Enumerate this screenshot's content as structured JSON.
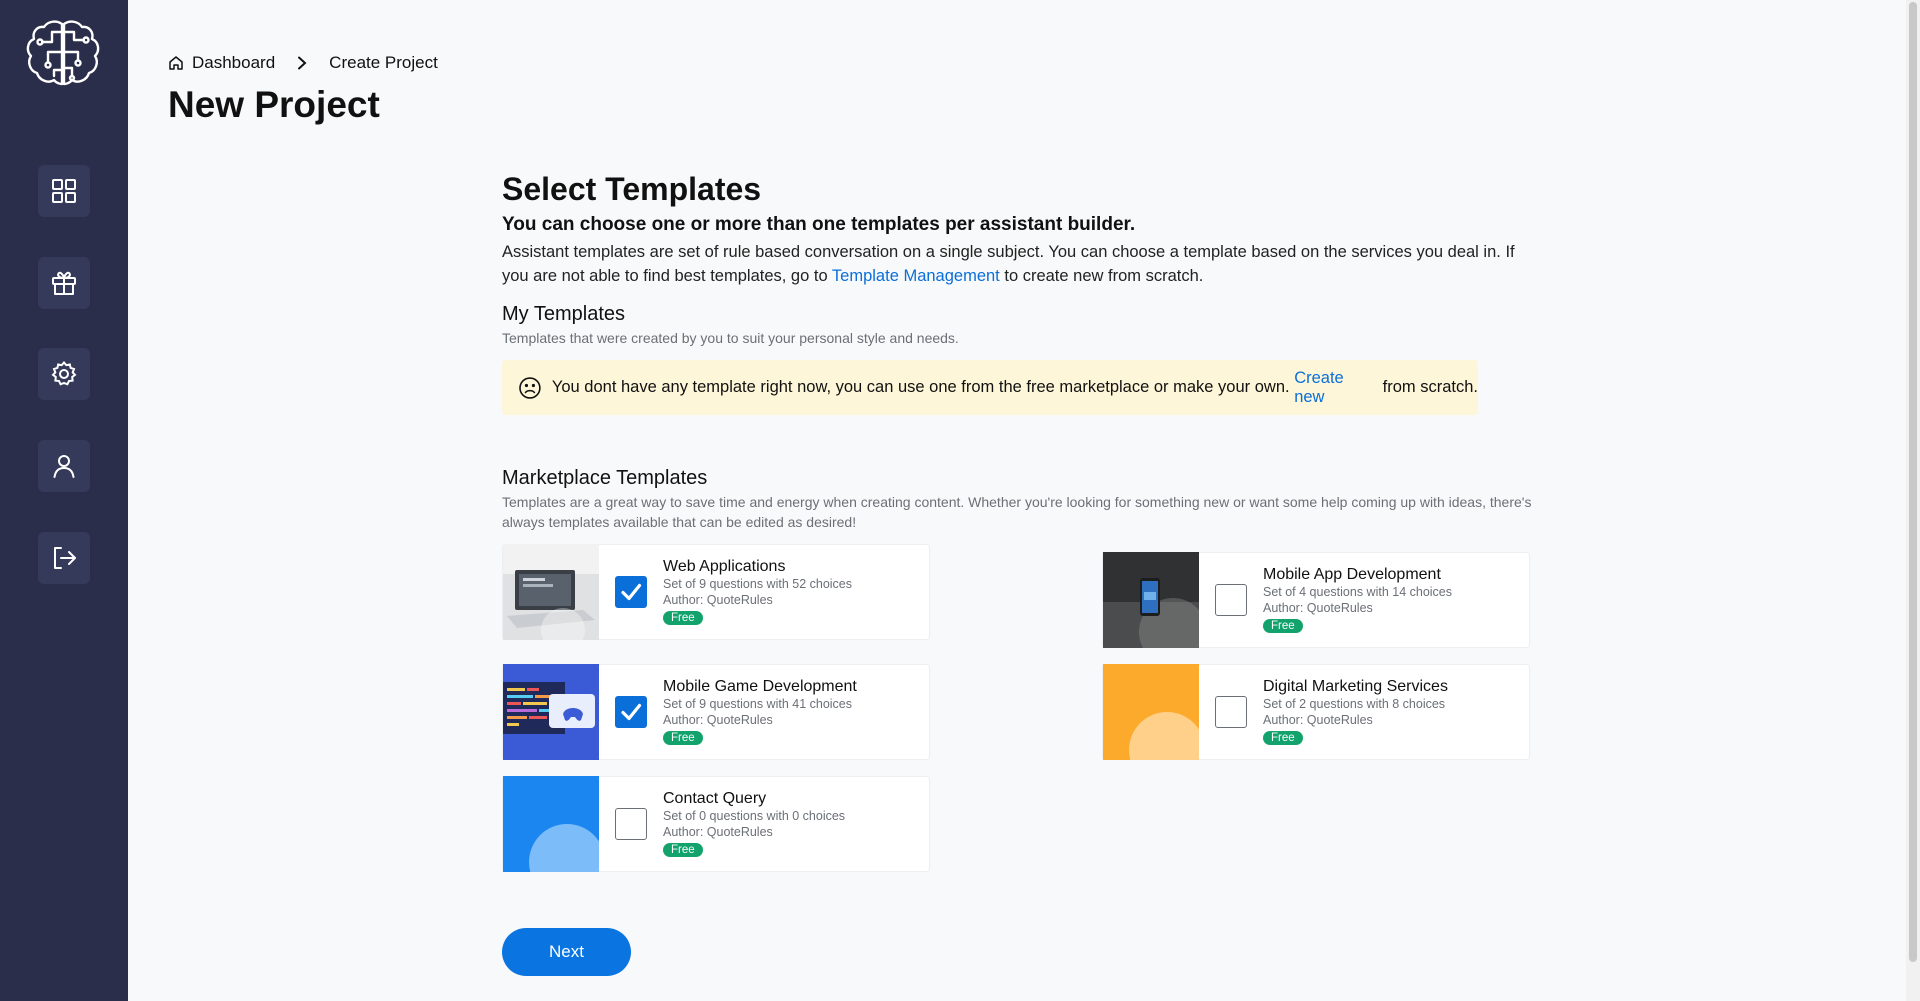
{
  "sidebar": {
    "items": [
      {
        "name": "dashboard-grid",
        "icon": "grid-icon"
      },
      {
        "name": "gifts",
        "icon": "gift-icon"
      },
      {
        "name": "settings",
        "icon": "gear-icon"
      },
      {
        "name": "profile",
        "icon": "user-icon"
      },
      {
        "name": "logout",
        "icon": "logout-icon"
      }
    ],
    "bg": "#2b2e4b"
  },
  "breadcrumb": {
    "home": "Dashboard",
    "current": "Create Project"
  },
  "page_title": "New Project",
  "select": {
    "title": "Select Templates",
    "subtitle": "You can choose one or more than one templates per assistant builder.",
    "desc_before": "Assistant templates are set of rule based conversation on a single subject. You can choose a template based on the services you deal in. If you are not able to find best templates, go to ",
    "desc_link": "Template Management",
    "desc_after": " to create new from scratch."
  },
  "my_templates": {
    "title": "My Templates",
    "desc": "Templates that were created by you to suit your personal style and needs.",
    "alert_before": "You dont have any template right now, you can use one from the free marketplace or make your own. ",
    "alert_link": "Create new",
    "alert_after": " from scratch."
  },
  "marketplace": {
    "title": "Marketplace Templates",
    "desc": "Templates are a great way to save time and energy when creating content. Whether you're looking for something new or want some help coming up with ideas, there's always templates available that can be edited as desired!",
    "cards": [
      {
        "name": "Web Applications",
        "meta": "Set of 9 questions with 52 choices",
        "author": "Author: QuoteRules",
        "badge": "Free",
        "checked": true
      },
      {
        "name": "Mobile App Development",
        "meta": "Set of 4 questions with 14 choices",
        "author": "Author: QuoteRules",
        "badge": "Free",
        "checked": false
      },
      {
        "name": "Mobile Game Development",
        "meta": "Set of 9 questions with 41 choices",
        "author": "Author: QuoteRules",
        "badge": "Free",
        "checked": true
      },
      {
        "name": "Digital Marketing Services",
        "meta": "Set of 2 questions with 8 choices",
        "author": "Author: QuoteRules",
        "badge": "Free",
        "checked": false
      },
      {
        "name": "Contact Query",
        "meta": "Set of 0 questions with 0 choices",
        "author": "Author: QuoteRules",
        "badge": "Free",
        "checked": false
      }
    ]
  },
  "next_label": "Next",
  "colors": {
    "accent": "#0a6fd8",
    "badge": "#12a26b",
    "alert_bg": "#fdf6d8"
  }
}
